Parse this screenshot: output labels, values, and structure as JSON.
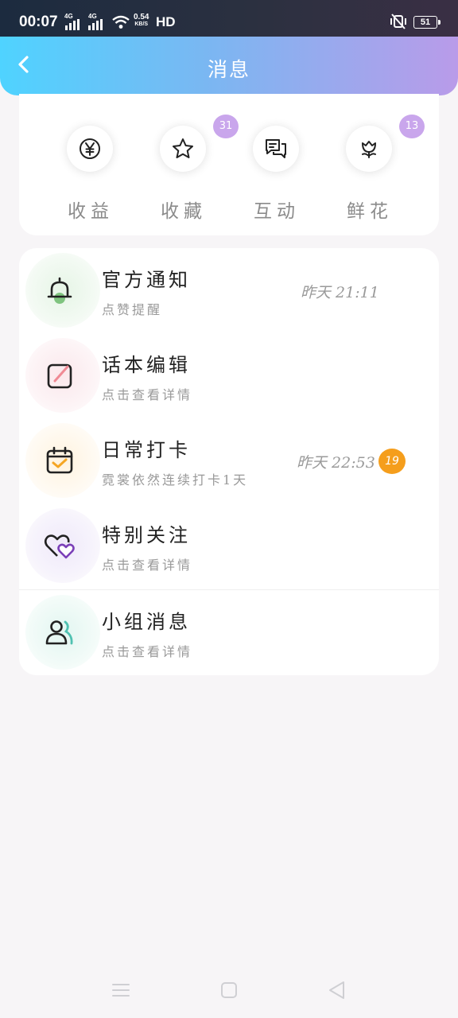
{
  "status_bar": {
    "time": "00:07",
    "net1": "4G",
    "net2": "4G",
    "speed_value": "0.54",
    "speed_unit": "KB/S",
    "hd": "HD",
    "battery": "51"
  },
  "header": {
    "title": "消息",
    "back_icon": "chevron-left-icon"
  },
  "quick_actions": [
    {
      "label": "收益",
      "icon": "yen-coin-icon",
      "badge": ""
    },
    {
      "label": "收藏",
      "icon": "star-icon",
      "badge": "31"
    },
    {
      "label": "互动",
      "icon": "chat-bubbles-icon",
      "badge": ""
    },
    {
      "label": "鲜花",
      "icon": "flower-icon",
      "badge": "13"
    }
  ],
  "messages": [
    {
      "title": "官方通知",
      "subtitle": "点赞提醒",
      "time": "昨天 21:11",
      "badge": "",
      "icon": "bell-icon",
      "icon_bg": "#eef8ee"
    },
    {
      "title": "话本编辑",
      "subtitle": "点击查看详情",
      "time": "",
      "badge": "",
      "icon": "edit-icon",
      "icon_bg": "#fdf0f2"
    },
    {
      "title": "日常打卡",
      "subtitle": "霓裳依然连续打卡1天",
      "time": "昨天 22:53",
      "badge": "19",
      "icon": "calendar-check-icon",
      "icon_bg": "#fff8ec"
    },
    {
      "title": "特别关注",
      "subtitle": "点击查看详情",
      "time": "",
      "badge": "",
      "icon": "hearts-icon",
      "icon_bg": "#f4f0fb"
    },
    {
      "title": "小组消息",
      "subtitle": "点击查看详情",
      "time": "",
      "badge": "",
      "icon": "group-icon",
      "icon_bg": "#eefaf7"
    }
  ],
  "nav_bar": {
    "menu_icon": "menu-icon",
    "home_icon": "home-square-icon",
    "back_icon": "back-triangle-icon"
  },
  "colors": {
    "header_gradient_start": "#4fd3ff",
    "header_gradient_end": "#b99be9",
    "badge_purple": "#c9a6ec",
    "badge_orange": "#f59e1c"
  }
}
